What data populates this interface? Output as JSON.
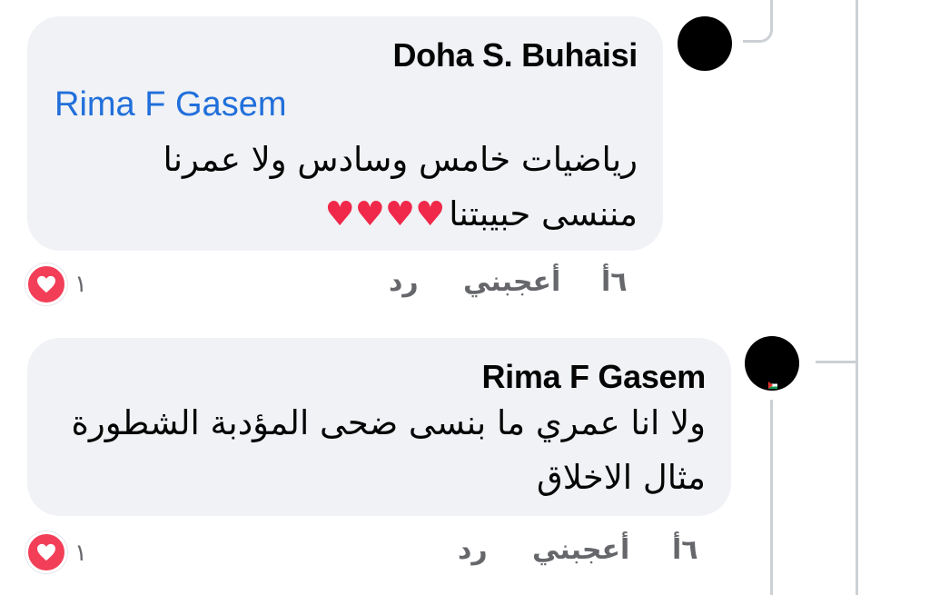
{
  "comments": [
    {
      "author": "Doha S. Buhaisi",
      "mention": "Rima F Gasem",
      "text_line1": "رياضيات خامس وسادس ولا عمرنا",
      "text_line2": "مننسى حبيبتنا",
      "emoji": "♥♥♥♥",
      "time": "٦أ",
      "like_label": "أعجبني",
      "reply_label": "رد",
      "reaction_count": "١",
      "reaction_icon": "love-heart-icon"
    },
    {
      "author": "Rima F Gasem",
      "text_line1": "ولا انا عمري ما بنسى ضحى المؤدبة الشطورة",
      "text_line2": "مثال الاخلاق",
      "time": "٦أ",
      "like_label": "أعجبني",
      "reply_label": "رد",
      "reaction_count": "١",
      "reaction_icon": "love-heart-icon"
    }
  ],
  "colors": {
    "bubble": "#f0f2f5",
    "mention": "#216fdb",
    "secondary_text": "#65676b",
    "love_reaction": "#f33e58",
    "thread_line": "#ccd0d5"
  }
}
